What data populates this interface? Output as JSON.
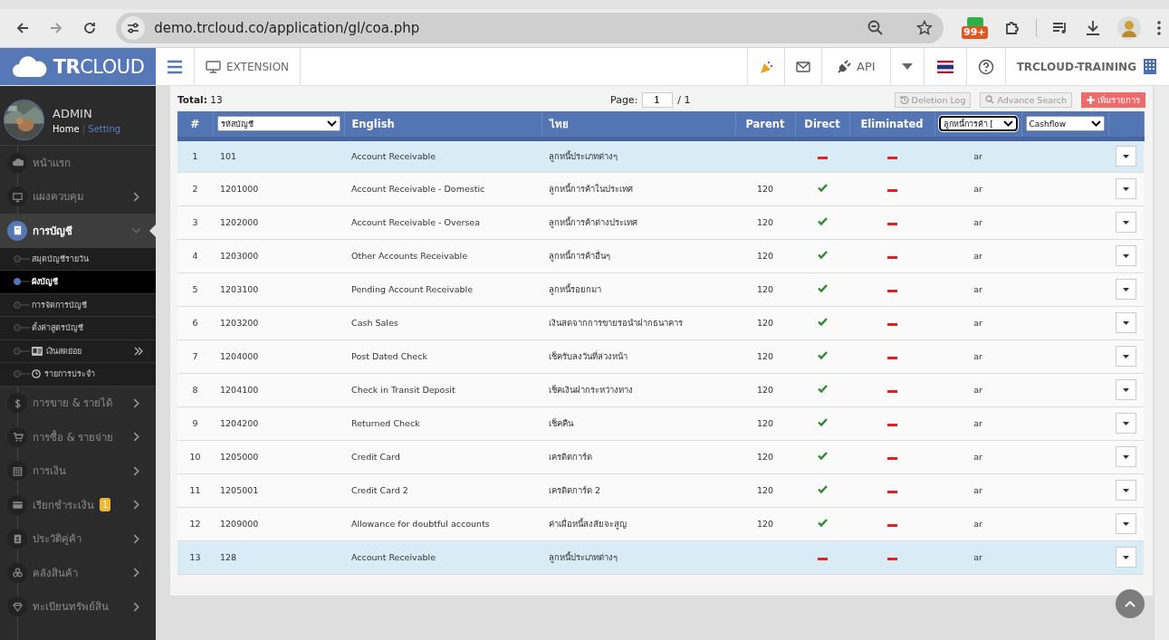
{
  "browser": {
    "url": "demo.trcloud.co/application/gl/coa.php",
    "extension_badge": "99+"
  },
  "topbar": {
    "logo": "**TR**CLOUD",
    "extension": "EXTENSION",
    "api": "API",
    "company": "TRCLOUD-TRAINING"
  },
  "sidebar": {
    "user": {
      "name": "ADMIN",
      "home": "Home",
      "separator": "|",
      "setting": "Setting"
    },
    "items": [
      {
        "label": "หน้าแรก",
        "selected": false,
        "kind": "link"
      },
      {
        "label": "แผงควบคุม",
        "selected": false,
        "expanded": false,
        "kind": "menu"
      },
      {
        "label": "การบัญชี",
        "selected": true,
        "expanded": true,
        "kind": "menu",
        "children": [
          {
            "label": "สมุดบัญชีรายวัน",
            "selected": false
          },
          {
            "label": "ผังบัญชี",
            "selected": true
          },
          {
            "label": "การจัดการบัญชี",
            "selected": false
          },
          {
            "label": "ตั้งค่าสูตรบัญชี",
            "selected": false
          },
          {
            "label": "เงินสดย่อย",
            "selected": false,
            "kind": "group"
          },
          {
            "label": "รายการประจำ",
            "selected": false,
            "kind": "clock"
          }
        ]
      },
      {
        "label": "การขาย & รายได้",
        "selected": false,
        "expanded": false,
        "kind": "menu"
      },
      {
        "label": "การซื้อ & รายจ่าย",
        "selected": false,
        "expanded": false,
        "kind": "menu"
      },
      {
        "label": "การเงิน",
        "selected": false,
        "expanded": false,
        "kind": "menu"
      },
      {
        "label": "เรียกชำระเงิน",
        "selected": false,
        "expanded": false,
        "kind": "menu",
        "badge": "1"
      },
      {
        "label": "ประวัติคู่ค้า",
        "selected": false,
        "expanded": false,
        "kind": "menu"
      },
      {
        "label": "คลังสินค้า",
        "selected": false,
        "expanded": false,
        "kind": "menu"
      },
      {
        "label": "ทะเบียนทรัพย์สิน",
        "selected": false,
        "expanded": false,
        "kind": "menu"
      }
    ]
  },
  "toolbar": {
    "total": "**Total:** 13",
    "page_label": "Page:",
    "page": "1",
    "page_count": "/ 1",
    "buttons": [
      {
        "label": "Deletion Log",
        "kind": "history"
      },
      {
        "label": "Advance Search",
        "kind": "search"
      },
      {
        "label": "เพิ่มรายการ",
        "kind": "add"
      }
    ]
  },
  "table": {
    "columns": [
      {
        "kind": "text",
        "label": "#"
      },
      {
        "kind": "select",
        "label": "รหัสบัญชี",
        "focused": false
      },
      {
        "kind": "text",
        "label": "English"
      },
      {
        "kind": "text",
        "label": "ไทย"
      },
      {
        "kind": "text",
        "label": "Parent"
      },
      {
        "kind": "text",
        "label": "Direct"
      },
      {
        "kind": "text",
        "label": "Eliminated"
      },
      {
        "kind": "select",
        "label": "ลูกหนี้การค้า [",
        "focused": true
      },
      {
        "kind": "select",
        "label": "Cashflow",
        "focused": false
      }
    ],
    "rows": [
      {
        "no": "1",
        "code": "101",
        "english": "Account Receivable",
        "thai": "ลูกหนี้ประเภทต่างๆ",
        "direct": false,
        "eliminated": false,
        "group": "ar",
        "highlighted": true
      },
      {
        "no": "2",
        "code": "1201000",
        "english": "Account Receivable - Domestic",
        "thai": "ลูกหนี้การค้าในประเทศ",
        "parent": "120",
        "direct": true,
        "eliminated": false,
        "group": "ar",
        "highlighted": false
      },
      {
        "no": "3",
        "code": "1202000",
        "english": "Account Receivable - Oversea",
        "thai": "ลูกหนี้การค้าต่างประเทศ",
        "parent": "120",
        "direct": true,
        "eliminated": false,
        "group": "ar",
        "highlighted": false
      },
      {
        "no": "4",
        "code": "1203000",
        "english": "Other Accounts Receivable",
        "thai": "ลูกหนี้การค้าอื่นๆ",
        "parent": "120",
        "direct": true,
        "eliminated": false,
        "group": "ar",
        "highlighted": false
      },
      {
        "no": "5",
        "code": "1203100",
        "english": "Pending Account Receivable",
        "thai": "ลูกหนี้รอยกมา",
        "parent": "120",
        "direct": true,
        "eliminated": false,
        "group": "ar",
        "highlighted": false
      },
      {
        "no": "6",
        "code": "1203200",
        "english": "Cash Sales",
        "thai": "เงินสดจากการขายรอนำฝากธนาคาร",
        "parent": "120",
        "direct": true,
        "eliminated": false,
        "group": "ar",
        "highlighted": false
      },
      {
        "no": "7",
        "code": "1204000",
        "english": "Post Dated Check",
        "thai": "เช็ครับลงวันที่ล่วงหน้า",
        "parent": "120",
        "direct": true,
        "eliminated": false,
        "group": "ar",
        "highlighted": false
      },
      {
        "no": "8",
        "code": "1204100",
        "english": "Check in Transit Deposit",
        "thai": "เช็คเงินฝากระหว่างทาง",
        "parent": "120",
        "direct": true,
        "eliminated": false,
        "group": "ar",
        "highlighted": false
      },
      {
        "no": "9",
        "code": "1204200",
        "english": "Returned Check",
        "thai": "เช็คคืน",
        "parent": "120",
        "direct": true,
        "eliminated": false,
        "group": "ar",
        "highlighted": false
      },
      {
        "no": "10",
        "code": "1205000",
        "english": "Credit Card",
        "thai": "เครดิตการ์ด",
        "parent": "120",
        "direct": true,
        "eliminated": false,
        "group": "ar",
        "highlighted": false
      },
      {
        "no": "11",
        "code": "1205001",
        "english": "Credit Card 2",
        "thai": "เครดิตการ์ด 2",
        "parent": "120",
        "direct": true,
        "eliminated": false,
        "group": "ar",
        "highlighted": false
      },
      {
        "no": "12",
        "code": "1209000",
        "english": "Allowance for doubtful accounts",
        "thai": "ค่าเผื่อหนี้สงสัยจะสูญ",
        "parent": "120",
        "direct": true,
        "eliminated": false,
        "group": "ar",
        "highlighted": false
      },
      {
        "no": "13",
        "code": "128",
        "english": "Account Receivable",
        "thai": "ลูกหนี้ประเภทต่างๆ",
        "direct": false,
        "eliminated": false,
        "group": "ar",
        "highlighted": true
      }
    ]
  }
}
